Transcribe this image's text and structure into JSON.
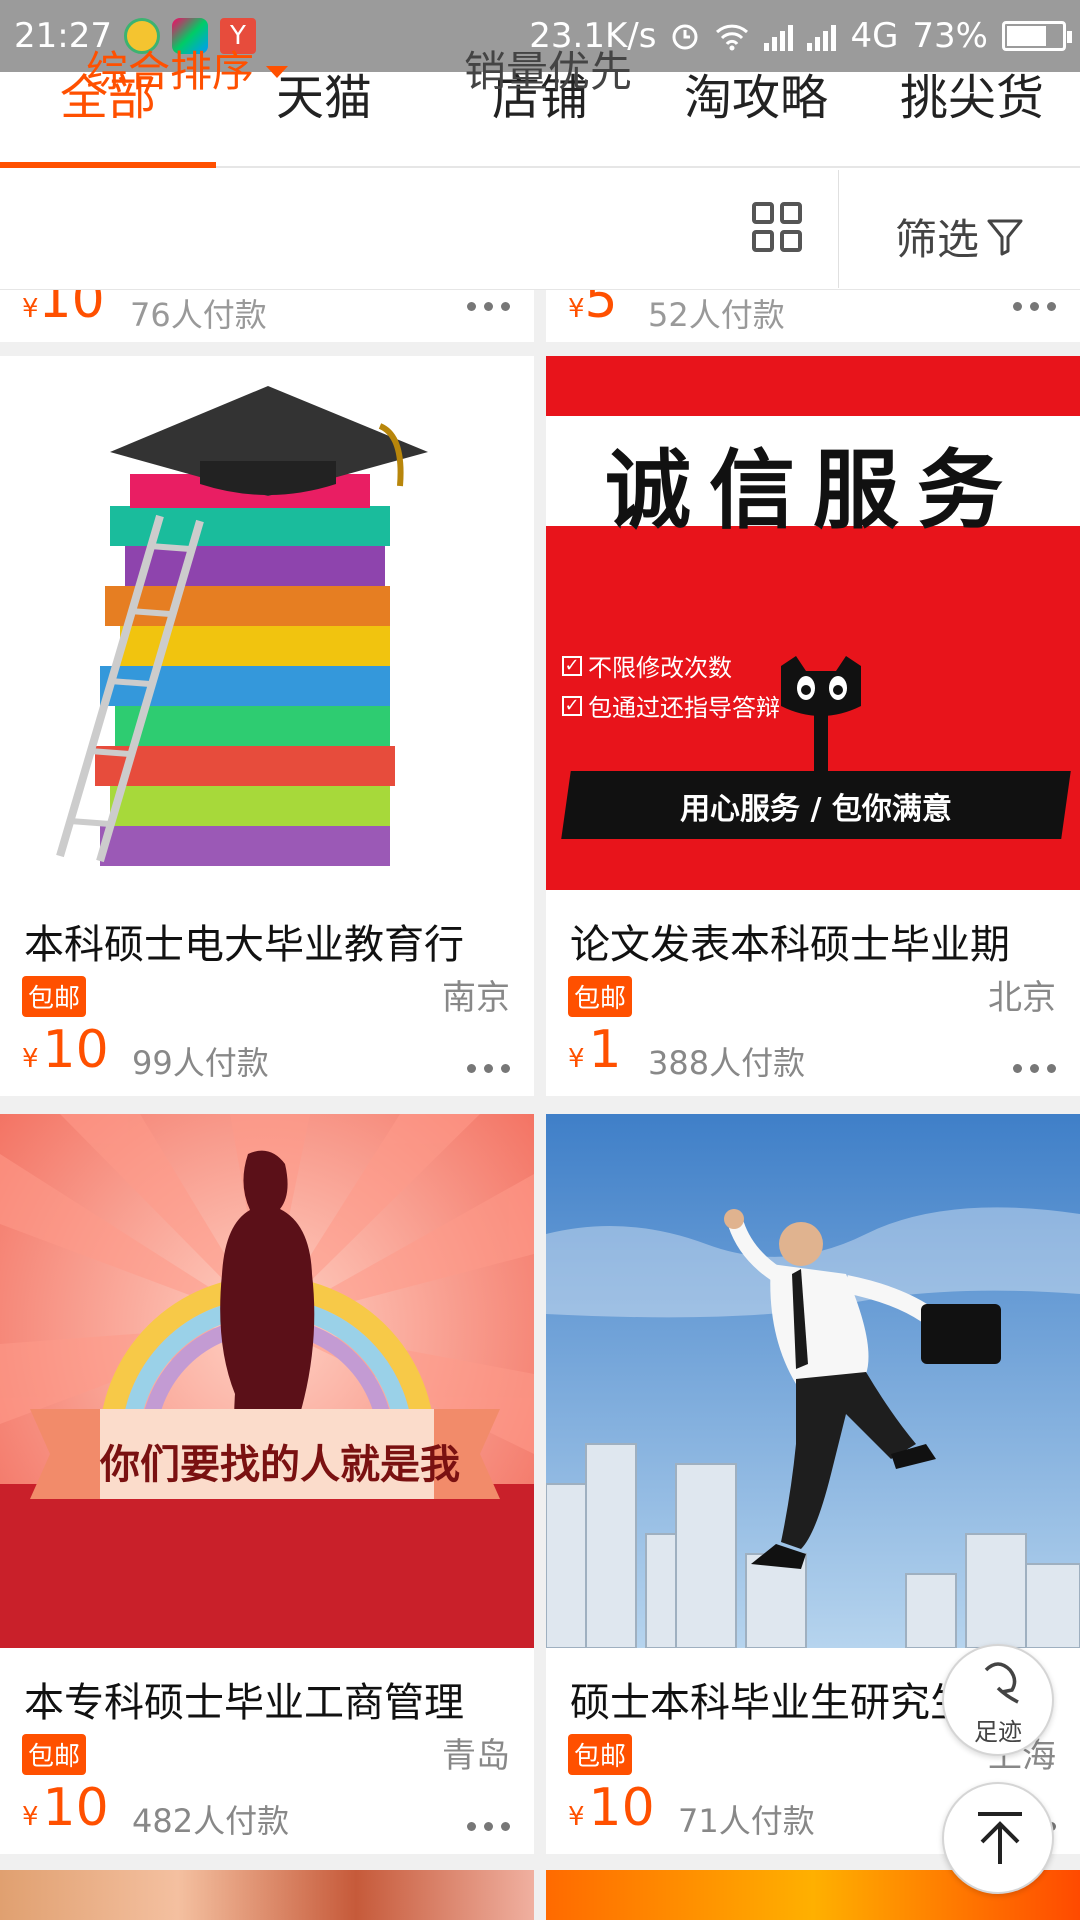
{
  "status_bar": {
    "time": "21:27",
    "net_speed": "23.1K/s",
    "network_type": "4G",
    "battery_percent": "73%",
    "battery_level": 0.73,
    "app_icon_3_text": "Y"
  },
  "tabs": [
    {
      "label": "全部",
      "active": true
    },
    {
      "label": "天猫",
      "active": false
    },
    {
      "label": "店铺",
      "active": false
    },
    {
      "label": "淘攻略",
      "active": false
    },
    {
      "label": "挑尖货",
      "active": false
    }
  ],
  "sort": {
    "main_label": "综合排序",
    "sales_label": "销量优先",
    "filter_label": "筛选"
  },
  "partial_top": [
    {
      "price": "10",
      "paid": "76人付款"
    },
    {
      "price": "5",
      "paid": "52人付款"
    }
  ],
  "products": [
    {
      "title": "本科硕士电大毕业教育行",
      "badge": "包邮",
      "city": "南京",
      "currency": "¥",
      "price": "10",
      "paid": "99人付款",
      "image": "graduation-books-icon"
    },
    {
      "title": "论文发表本科硕士毕业期",
      "badge": "包邮",
      "city": "北京",
      "currency": "¥",
      "price": "1",
      "paid": "388人付款",
      "image": "honesty-service-banner",
      "image_text": {
        "headline": "诚信服务",
        "check1": "不限修改次数",
        "check2": "包通过还指导答辩",
        "slogan": "用心服务 / 包你满意"
      }
    },
    {
      "title": "本专科硕士毕业工商管理",
      "badge": "包邮",
      "city": "青岛",
      "currency": "¥",
      "price": "10",
      "paid": "482人付款",
      "image": "silhouette-banner",
      "image_text": {
        "ribbon": "你们要找的人就是我"
      }
    },
    {
      "title": "硕士本科毕业生研究生",
      "badge": "包邮",
      "city": "上海",
      "currency": "¥",
      "price": "10",
      "paid": "71人付款",
      "image": "jumping-businessman-photo"
    }
  ],
  "floating": {
    "footprint_label": "足迹"
  },
  "colors": {
    "accent": "#ff5000",
    "status_bar": "#9b9b9b"
  }
}
